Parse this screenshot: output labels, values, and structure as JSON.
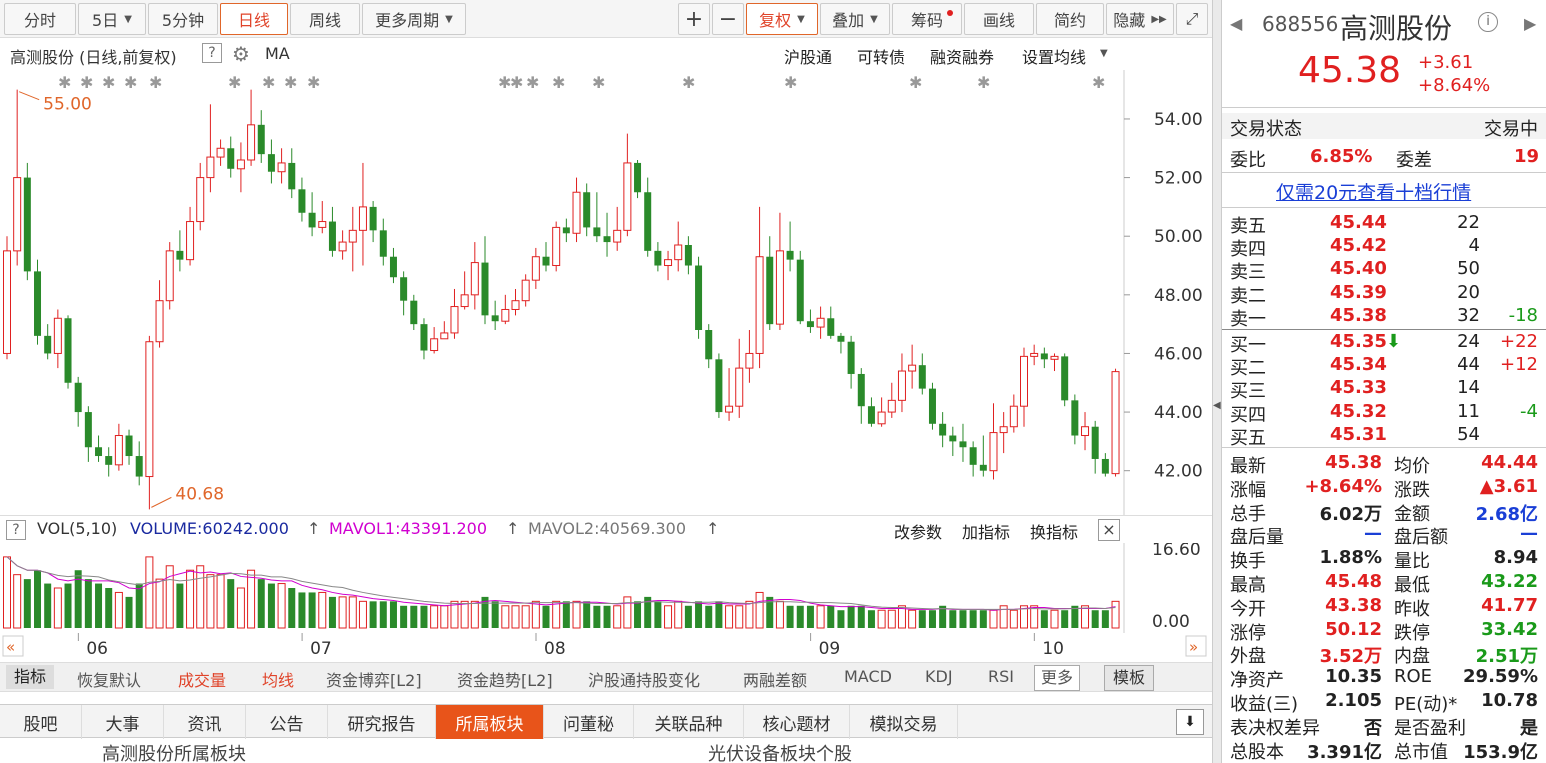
{
  "toolbar": {
    "periods": [
      "分时",
      "5日",
      "5分钟",
      "日线",
      "周线",
      "更多周期"
    ],
    "zoom_in": "+",
    "zoom_out": "−",
    "fuquan": "复权",
    "overlay": "叠加",
    "chouma": "筹码",
    "draw": "画线",
    "simple": "简约",
    "hide": "隐藏"
  },
  "chart_header": {
    "title": "高测股份 (日线,前复权)",
    "help": "?",
    "ma": "MA",
    "links": [
      "沪股通",
      "可转债",
      "融资融券",
      "设置均线"
    ]
  },
  "price_chart": {
    "y_ticks": [
      "54.00",
      "52.00",
      "50.00",
      "48.00",
      "46.00",
      "44.00",
      "42.00"
    ],
    "high_label": "55.00",
    "low_label": "40.68",
    "s_mark": "S"
  },
  "chart_data": {
    "type": "candlestick",
    "y_range": [
      41,
      55.5
    ],
    "candles": [
      [
        46.0,
        49.5,
        45.8,
        50.0
      ],
      [
        49.5,
        52.0,
        49.0,
        55.0
      ],
      [
        52.0,
        48.8,
        48.5,
        52.5
      ],
      [
        48.8,
        46.6,
        46.3,
        49.2
      ],
      [
        46.6,
        46.0,
        45.8,
        47.0
      ],
      [
        46.0,
        47.2,
        45.5,
        47.5
      ],
      [
        47.2,
        45.0,
        44.8,
        47.3
      ],
      [
        45.0,
        44.0,
        43.5,
        45.2
      ],
      [
        44.0,
        42.8,
        42.3,
        44.2
      ],
      [
        42.8,
        42.5,
        42.3,
        43.2
      ],
      [
        42.5,
        42.2,
        41.8,
        42.8
      ],
      [
        42.2,
        43.2,
        42.0,
        43.6
      ],
      [
        43.2,
        42.5,
        42.2,
        43.4
      ],
      [
        42.5,
        41.8,
        41.5,
        43.0
      ],
      [
        41.8,
        46.4,
        40.68,
        46.6
      ],
      [
        46.4,
        47.8,
        46.2,
        48.5
      ],
      [
        47.8,
        49.5,
        47.5,
        49.8
      ],
      [
        49.5,
        49.2,
        48.8,
        50.2
      ],
      [
        49.2,
        50.5,
        49.0,
        51.0
      ],
      [
        50.5,
        52.0,
        50.2,
        52.5
      ],
      [
        52.0,
        52.7,
        51.5,
        54.5
      ],
      [
        52.7,
        53.0,
        52.4,
        53.3
      ],
      [
        53.0,
        52.3,
        52.0,
        53.4
      ],
      [
        52.3,
        52.6,
        51.5,
        53.2
      ],
      [
        52.6,
        53.8,
        52.4,
        55.0
      ],
      [
        53.8,
        52.8,
        52.5,
        54.3
      ],
      [
        52.8,
        52.2,
        51.8,
        53.3
      ],
      [
        52.2,
        52.5,
        51.8,
        53.0
      ],
      [
        52.5,
        51.6,
        51.3,
        53.0
      ],
      [
        51.6,
        50.8,
        50.5,
        52.0
      ],
      [
        50.8,
        50.3,
        50.0,
        51.5
      ],
      [
        50.3,
        50.5,
        50.1,
        51.2
      ],
      [
        50.5,
        49.5,
        49.3,
        51.0
      ],
      [
        49.5,
        49.8,
        49.2,
        50.2
      ],
      [
        49.8,
        50.2,
        48.8,
        51.0
      ],
      [
        50.2,
        51.0,
        49.0,
        52.5
      ],
      [
        51.0,
        50.2,
        49.8,
        51.2
      ],
      [
        50.2,
        49.3,
        49.0,
        50.6
      ],
      [
        49.3,
        48.6,
        48.4,
        49.6
      ],
      [
        48.6,
        47.8,
        47.3,
        48.8
      ],
      [
        47.8,
        47.0,
        46.8,
        48.0
      ],
      [
        47.0,
        46.1,
        45.8,
        47.2
      ],
      [
        46.1,
        46.5,
        46.0,
        46.9
      ],
      [
        46.5,
        46.7,
        46.5,
        47.1
      ],
      [
        46.7,
        47.6,
        46.5,
        48.2
      ],
      [
        47.6,
        48.0,
        47.5,
        48.8
      ],
      [
        48.0,
        49.1,
        47.5,
        49.8
      ],
      [
        49.1,
        47.3,
        47.0,
        50.0
      ],
      [
        47.3,
        47.1,
        46.8,
        47.8
      ],
      [
        47.1,
        47.5,
        47.0,
        48.0
      ],
      [
        47.5,
        47.8,
        47.3,
        48.2
      ],
      [
        47.8,
        48.5,
        47.6,
        48.7
      ],
      [
        48.5,
        49.3,
        48.2,
        49.6
      ],
      [
        49.3,
        49.0,
        48.8,
        49.8
      ],
      [
        49.0,
        50.3,
        48.8,
        50.5
      ],
      [
        50.3,
        50.1,
        49.8,
        50.6
      ],
      [
        50.1,
        51.5,
        49.8,
        52.0
      ],
      [
        51.5,
        50.3,
        50.0,
        51.8
      ],
      [
        50.3,
        50.0,
        49.8,
        51.5
      ],
      [
        50.0,
        49.8,
        49.3,
        50.8
      ],
      [
        49.8,
        50.2,
        49.5,
        51.0
      ],
      [
        50.2,
        52.5,
        50.0,
        53.5
      ],
      [
        52.5,
        51.5,
        51.3,
        52.6
      ],
      [
        51.5,
        49.5,
        49.3,
        52.0
      ],
      [
        49.5,
        49.0,
        48.8,
        49.8
      ],
      [
        49.0,
        49.2,
        48.5,
        49.5
      ],
      [
        49.2,
        49.7,
        48.8,
        50.5
      ],
      [
        49.7,
        49.0,
        48.7,
        50.0
      ],
      [
        49.0,
        46.8,
        46.5,
        49.3
      ],
      [
        46.8,
        45.8,
        45.5,
        47.0
      ],
      [
        45.8,
        44.0,
        43.8,
        46.0
      ],
      [
        44.0,
        44.2,
        43.7,
        45.5
      ],
      [
        44.2,
        45.5,
        43.8,
        46.5
      ],
      [
        45.5,
        46.0,
        45.0,
        46.8
      ],
      [
        46.0,
        49.3,
        45.5,
        51.0
      ],
      [
        49.3,
        47.0,
        46.8,
        50.0
      ],
      [
        47.0,
        49.5,
        46.8,
        50.8
      ],
      [
        49.5,
        49.2,
        48.8,
        50.5
      ],
      [
        49.2,
        47.1,
        47.0,
        49.5
      ],
      [
        47.1,
        46.9,
        46.7,
        47.5
      ],
      [
        46.9,
        47.2,
        46.5,
        47.6
      ],
      [
        47.2,
        46.6,
        46.5,
        47.6
      ],
      [
        46.6,
        46.4,
        46.0,
        46.7
      ],
      [
        46.4,
        45.3,
        44.8,
        46.6
      ],
      [
        45.3,
        44.2,
        43.6,
        45.5
      ],
      [
        44.2,
        43.6,
        43.5,
        44.5
      ],
      [
        43.6,
        44.0,
        43.5,
        44.5
      ],
      [
        44.0,
        44.4,
        43.8,
        45.0
      ],
      [
        44.4,
        45.4,
        44.0,
        46.0
      ],
      [
        45.4,
        45.6,
        44.8,
        46.3
      ],
      [
        45.6,
        44.8,
        44.6,
        46.0
      ],
      [
        44.8,
        43.6,
        43.4,
        45.0
      ],
      [
        43.6,
        43.2,
        42.8,
        44.0
      ],
      [
        43.2,
        43.0,
        42.5,
        43.5
      ],
      [
        43.0,
        42.8,
        42.3,
        43.6
      ],
      [
        42.8,
        42.2,
        41.8,
        43.0
      ],
      [
        42.2,
        42.0,
        41.8,
        43.2
      ],
      [
        42.0,
        43.3,
        41.7,
        44.3
      ],
      [
        43.3,
        43.5,
        42.6,
        44.0
      ],
      [
        43.5,
        44.2,
        43.3,
        44.6
      ],
      [
        44.2,
        45.9,
        43.5,
        46.2
      ],
      [
        45.9,
        46.0,
        45.6,
        46.3
      ],
      [
        46.0,
        45.8,
        45.5,
        46.2
      ],
      [
        45.8,
        45.9,
        45.4,
        46.0
      ],
      [
        45.9,
        44.4,
        44.2,
        46.0
      ],
      [
        44.4,
        43.2,
        42.9,
        44.6
      ],
      [
        43.2,
        43.5,
        42.7,
        44.0
      ],
      [
        43.5,
        42.4,
        41.9,
        43.7
      ],
      [
        42.4,
        41.9,
        41.8,
        42.6
      ],
      [
        41.9,
        45.38,
        41.8,
        45.48
      ]
    ],
    "volumes": [
      16,
      12,
      11,
      13,
      10,
      9,
      10,
      13,
      11,
      10,
      9,
      8,
      7,
      10,
      16,
      11,
      14,
      10,
      13,
      14,
      12,
      12,
      11,
      9,
      13,
      11,
      10,
      10,
      9,
      8,
      8,
      8,
      7,
      7,
      7,
      6,
      6,
      6,
      6,
      5,
      5,
      5,
      5,
      5,
      6,
      6,
      6,
      7,
      6,
      5,
      5,
      5,
      6,
      5,
      6,
      6,
      6,
      6,
      5,
      5,
      5,
      7,
      6,
      7,
      6,
      5,
      6,
      5,
      6,
      5,
      6,
      5,
      5,
      6,
      8,
      7,
      6,
      5,
      5,
      5,
      5,
      5,
      4,
      5,
      5,
      4,
      4,
      4,
      5,
      4,
      4,
      4,
      5,
      4,
      4,
      4,
      4,
      4,
      5,
      4,
      5,
      5,
      4,
      4,
      4,
      5,
      5,
      4,
      4,
      6
    ],
    "x_ticks": [
      "06",
      "07",
      "08",
      "09",
      "10"
    ],
    "vol_y_ticks": [
      "16.60",
      "0.00"
    ]
  },
  "volume_header": {
    "help": "?",
    "name": "VOL(5,10)",
    "volume": "VOLUME:60242.000",
    "mavol1": "MAVOL1:43391.200",
    "mavol2": "MAVOL2:40569.300",
    "actions": [
      "改参数",
      "加指标",
      "换指标"
    ],
    "close": "×"
  },
  "indicators": {
    "items": [
      "指标",
      "恢复默认",
      "成交量",
      "均线",
      "资金博弈[L2]",
      "资金趋势[L2]",
      "沪股通持股变化",
      "两融差额",
      "MACD",
      "KDJ",
      "RSI",
      "更多",
      "模板"
    ]
  },
  "tabs": [
    "股吧",
    "大事",
    "资讯",
    "公告",
    "研究报告",
    "所属板块",
    "问董秘",
    "关联品种",
    "核心题材",
    "模拟交易"
  ],
  "bottom": {
    "left": "高测股份所属板块",
    "right": "光伏设备板块个股"
  },
  "quote": {
    "code": "688556",
    "name": "高测股份",
    "info": "i",
    "price": "45.38",
    "change": "+3.61",
    "pct": "+8.64%",
    "status_label": "交易状态",
    "status": "交易中",
    "weibi_label": "委比",
    "weibi": "6.85%",
    "weicha_label": "委差",
    "weicha": "19",
    "banner": "仅需20元查看十档行情",
    "sells": [
      {
        "label": "卖五",
        "price": "45.44",
        "vol": "22",
        "chg": ""
      },
      {
        "label": "卖四",
        "price": "45.42",
        "vol": "4",
        "chg": ""
      },
      {
        "label": "卖三",
        "price": "45.40",
        "vol": "50",
        "chg": ""
      },
      {
        "label": "卖二",
        "price": "45.39",
        "vol": "20",
        "chg": ""
      },
      {
        "label": "卖一",
        "price": "45.38",
        "vol": "32",
        "chg": "-18"
      }
    ],
    "buys": [
      {
        "label": "买一",
        "price": "45.35",
        "vol": "24",
        "chg": "+22"
      },
      {
        "label": "买二",
        "price": "45.34",
        "vol": "44",
        "chg": "+12"
      },
      {
        "label": "买三",
        "price": "45.33",
        "vol": "14",
        "chg": ""
      },
      {
        "label": "买四",
        "price": "45.32",
        "vol": "11",
        "chg": "-4"
      },
      {
        "label": "买五",
        "price": "45.31",
        "vol": "54",
        "chg": ""
      }
    ],
    "stats": [
      [
        "最新",
        "45.38",
        "均价",
        "44.44"
      ],
      [
        "涨幅",
        "+8.64%",
        "涨跌",
        "▲3.61"
      ],
      [
        "总手",
        "6.02万",
        "金额",
        "2.68亿"
      ],
      [
        "盘后量",
        "—",
        "盘后额",
        "—"
      ],
      [
        "换手",
        "1.88%",
        "量比",
        "8.94"
      ],
      [
        "最高",
        "45.48",
        "最低",
        "43.22"
      ],
      [
        "今开",
        "43.38",
        "昨收",
        "41.77"
      ],
      [
        "涨停",
        "50.12",
        "跌停",
        "33.42"
      ],
      [
        "外盘",
        "3.52万",
        "内盘",
        "2.51万"
      ],
      [
        "净资产",
        "10.35",
        "ROE",
        "29.59%"
      ],
      [
        "收益(三)",
        "2.105",
        "PE(动)*",
        "10.78"
      ],
      [
        "表决权差异",
        "否",
        "是否盈利",
        "是"
      ],
      [
        "总股本",
        "3.391亿",
        "总市值",
        "153.9亿"
      ]
    ]
  }
}
